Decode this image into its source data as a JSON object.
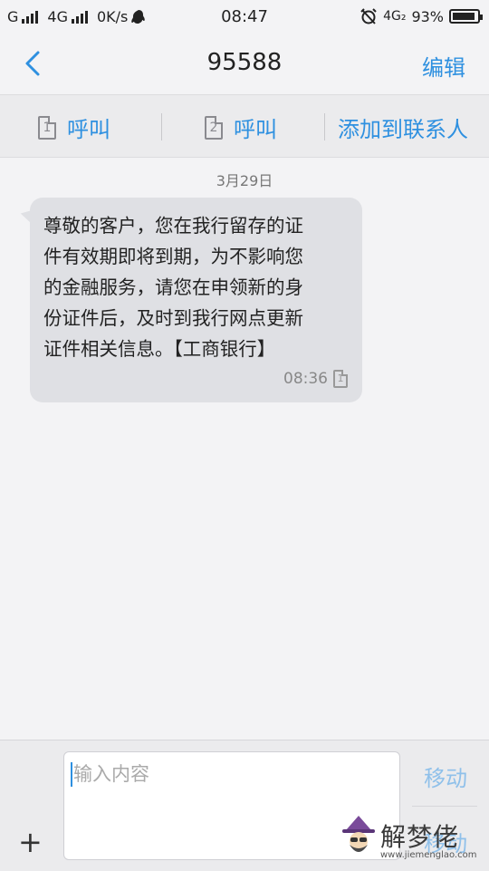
{
  "status_bar": {
    "carrier1": "G",
    "carrier2": "4G",
    "net_speed": "0K/s",
    "time": "08:47",
    "net_type": "4G₂",
    "battery": "93%"
  },
  "header": {
    "title": "95588",
    "edit_label": "编辑"
  },
  "actions": {
    "call_sim1_label": "呼叫",
    "sim1_number": "1",
    "call_sim2_label": "呼叫",
    "sim2_number": "2",
    "add_contact_label": "添加到联系人"
  },
  "conversation": {
    "date": "3月29日",
    "messages": [
      {
        "text": "尊敬的客户，您在我行留存的证\n件有效期即将到期，为不影响您\n的金融服务，请您在申领新的身\n份证件后，及时到我行网点更新\n证件相关信息。【工商银行】",
        "time": "08:36",
        "sim": "1"
      }
    ]
  },
  "composer": {
    "placeholder": "输入内容",
    "send_sim1_label": "移动",
    "send_sim2_label": "移动",
    "plus_label": "+"
  },
  "watermark": {
    "name": "解梦佬",
    "url": "www.jiemenglao.com"
  },
  "colors": {
    "accent": "#2e90e0",
    "bubble": "#dfe0e4",
    "background": "#f3f3f5"
  },
  "battery_level": 0.93
}
